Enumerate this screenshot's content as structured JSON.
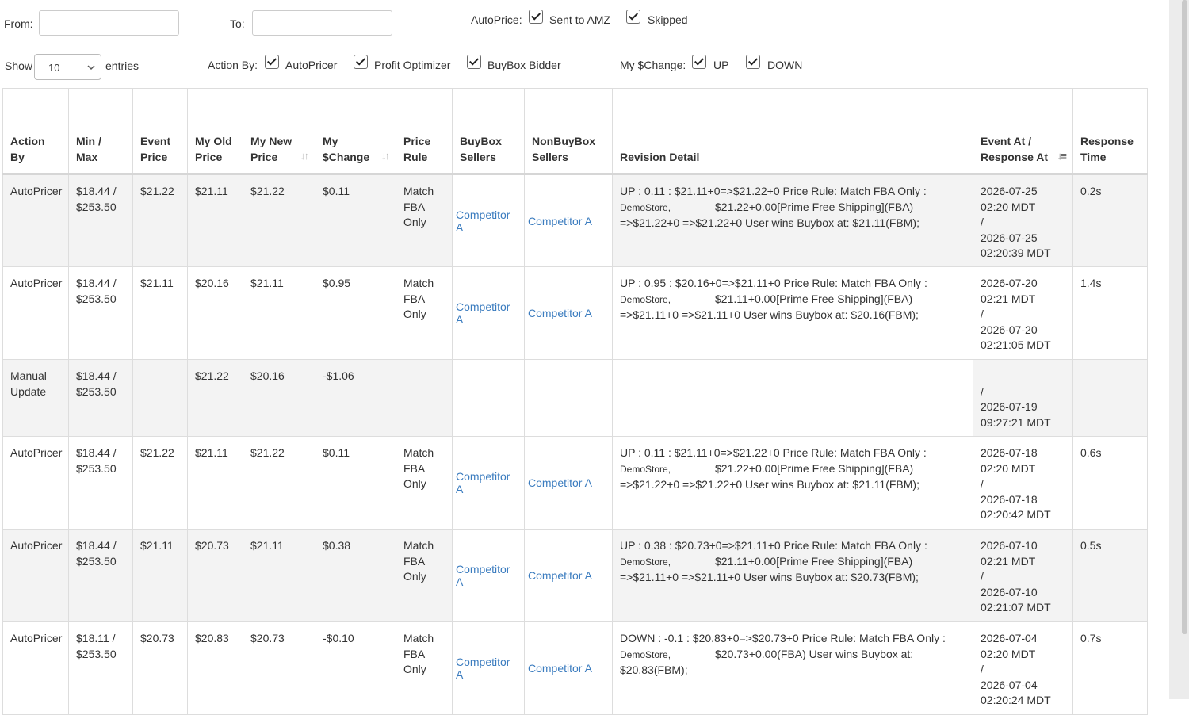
{
  "filters": {
    "from_label": "From:",
    "from_value": "",
    "to_label": "To:",
    "to_value": "",
    "autoprice_label": "AutoPrice:",
    "autoprice_options": [
      {
        "label": "Sent to AMZ",
        "checked": true
      },
      {
        "label": "Skipped",
        "checked": true
      }
    ],
    "show_label": "Show",
    "entries_value": "10",
    "entries_label": "entries",
    "action_by_label": "Action By:",
    "action_by_options": [
      {
        "label": "AutoPricer",
        "checked": true
      },
      {
        "label": "Profit Optimizer",
        "checked": true
      },
      {
        "label": "BuyBox Bidder",
        "checked": true
      }
    ],
    "change_label": "My $Change:",
    "change_options": [
      {
        "label": "UP",
        "checked": true
      },
      {
        "label": "DOWN",
        "checked": true
      }
    ]
  },
  "table": {
    "headers": {
      "action_by": "Action By",
      "min_max": "Min / Max",
      "event_price": "Event Price",
      "my_old_price": "My Old Price",
      "my_new_price": "My New Price",
      "my_change": "My $Change",
      "price_rule": "Price Rule",
      "buybox_sellers": "BuyBox Sellers",
      "nonbuybox_sellers": "NonBuyBox Sellers",
      "revision_detail": "Revision Detail",
      "event_at": "Event At / Response At",
      "response_time": "Response Time"
    },
    "rows": [
      {
        "action_by": "AutoPricer",
        "min": "$18.44 /",
        "max": "$253.50",
        "event_price": "$21.22",
        "old_price": "$21.11",
        "new_price": "$21.22",
        "change": "$0.11",
        "price_rule": "Match FBA Only",
        "buybox": "Competitor A",
        "nonbuybox": "Competitor A",
        "rev_1": "UP : 0.11 : $21.11+0=>$21.22+0 Price Rule: Match FBA Only :",
        "rev_store": "DemoStore,",
        "rev_2": "$21.22+0.00[Prime Free Shipping](FBA)",
        "rev_3": "=>$21.22+0 =>$21.22+0 User wins Buybox at: $21.11(FBM);",
        "event_at": "2026-07-25 02:20 MDT",
        "sep": "/",
        "response_at": "2026-07-25 02:20:39 MDT",
        "response_time": "0.2s"
      },
      {
        "action_by": "AutoPricer",
        "min": "$18.44 /",
        "max": "$253.50",
        "event_price": "$21.11",
        "old_price": "$20.16",
        "new_price": "$21.11",
        "change": "$0.95",
        "price_rule": "Match FBA Only",
        "buybox": "Competitor A",
        "nonbuybox": "Competitor A",
        "rev_1": "UP : 0.95 : $20.16+0=>$21.11+0 Price Rule: Match FBA Only :",
        "rev_store": "DemoStore,",
        "rev_2": "$21.11+0.00[Prime Free Shipping](FBA)",
        "rev_3": "=>$21.11+0 =>$21.11+0 User wins Buybox at: $20.16(FBM);",
        "event_at": "2026-07-20 02:21 MDT",
        "sep": "/",
        "response_at": "2026-07-20 02:21:05 MDT",
        "response_time": "1.4s"
      },
      {
        "action_by": "Manual Update",
        "min": "$18.44 /",
        "max": "$253.50",
        "event_price": "",
        "old_price": "$21.22",
        "new_price": "$20.16",
        "change": "-$1.06",
        "price_rule": "",
        "buybox": "",
        "nonbuybox": "",
        "rev_1": "",
        "rev_store": "",
        "rev_2": "",
        "rev_3": "",
        "event_at": "",
        "sep": "/",
        "response_at": "2026-07-19 09:27:21 MDT",
        "response_time": ""
      },
      {
        "action_by": "AutoPricer",
        "min": "$18.44 /",
        "max": "$253.50",
        "event_price": "$21.22",
        "old_price": "$21.11",
        "new_price": "$21.22",
        "change": "$0.11",
        "price_rule": "Match FBA Only",
        "buybox": "Competitor A",
        "nonbuybox": "Competitor A",
        "rev_1": "UP : 0.11 : $21.11+0=>$21.22+0 Price Rule: Match FBA Only :",
        "rev_store": "DemoStore,",
        "rev_2": "$21.22+0.00[Prime Free Shipping](FBA)",
        "rev_3": "=>$21.22+0 =>$21.22+0 User wins Buybox at: $21.11(FBM);",
        "event_at": "2026-07-18 02:20 MDT",
        "sep": "/",
        "response_at": "2026-07-18 02:20:42 MDT",
        "response_time": "0.6s"
      },
      {
        "action_by": "AutoPricer",
        "min": "$18.44 /",
        "max": "$253.50",
        "event_price": "$21.11",
        "old_price": "$20.73",
        "new_price": "$21.11",
        "change": "$0.38",
        "price_rule": "Match FBA Only",
        "buybox": "Competitor A",
        "nonbuybox": "Competitor A",
        "rev_1": "UP : 0.38 : $20.73+0=>$21.11+0 Price Rule: Match FBA Only :",
        "rev_store": "DemoStore,",
        "rev_2": "$21.11+0.00[Prime Free Shipping](FBA)",
        "rev_3": "=>$21.11+0 =>$21.11+0 User wins Buybox at: $20.73(FBM);",
        "event_at": "2026-07-10 02:21 MDT",
        "sep": "/",
        "response_at": "2026-07-10 02:21:07 MDT",
        "response_time": "0.5s"
      },
      {
        "action_by": "AutoPricer",
        "min": "$18.11 /",
        "max": "$253.50",
        "event_price": "$20.73",
        "old_price": "$20.83",
        "new_price": "$20.73",
        "change": "-$0.10",
        "price_rule": "Match FBA Only",
        "buybox": "Competitor A",
        "nonbuybox": "Competitor A",
        "rev_1": "DOWN : -0.1 : $20.83+0=>$20.73+0 Price Rule: Match FBA Only :",
        "rev_store": "DemoStore,",
        "rev_2": "$20.73+0.00(FBA) User wins Buybox at:",
        "rev_3": "$20.83(FBM);",
        "event_at": "2026-07-04 02:20 MDT",
        "sep": "/",
        "response_at": "2026-07-04 02:20:24 MDT",
        "response_time": "0.7s"
      }
    ]
  }
}
